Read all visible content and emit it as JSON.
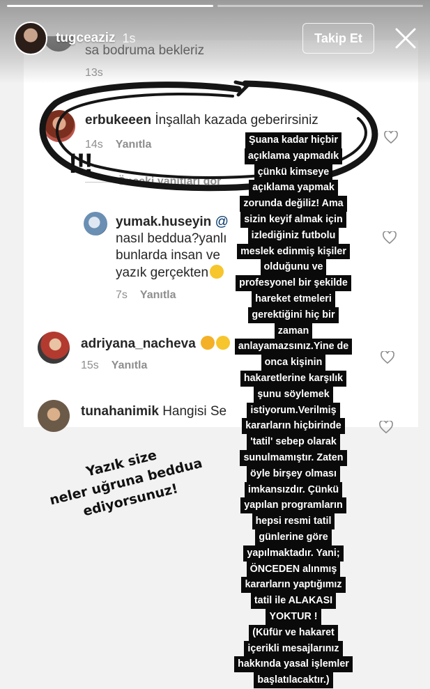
{
  "story": {
    "progress": [
      1.0,
      0.0
    ],
    "username": "tugceaziz",
    "time": "1s",
    "follow_label": "Takip Et",
    "close_icon": "close-icon"
  },
  "screenshot": {
    "prev_comment": {
      "text": "sa bodruma bekleriz",
      "time": "13s",
      "reply": "Yanıtla"
    },
    "comments": [
      {
        "user": "erbukeeen",
        "text": "İnşallah kazada geberirsiniz",
        "time": "14s",
        "reply": "Yanıtla",
        "view_replies": "Önceki yanıtları gör"
      },
      {
        "user": "yumak.huseyin",
        "mention": "@",
        "lines": [
          "nasıl beddua?yanlı",
          "bunlarda insan ve",
          "yazık gerçekten"
        ],
        "time": "7s",
        "reply": "Yanıtla"
      },
      {
        "user": "adriyana_nacheva",
        "time": "15s",
        "reply": "Yanıtla"
      },
      {
        "user": "tunahanimik",
        "text": "Hangisi Se"
      }
    ]
  },
  "overlay": {
    "exclaim": "!!!",
    "caption_lines": [
      "Yazık size",
      "neler uğruna beddua",
      "ediyorsunuz!"
    ],
    "statement_lines": [
      "Şuana kadar  hiçbir",
      "açıklama yapmadık",
      "çünkü kimseye",
      "açıklama yapmak",
      "zorunda değiliz! Ama",
      "sizin keyif almak için",
      "izlediğiniz futbolu",
      "meslek edinmiş kişiler",
      "olduğunu ve",
      "profesyonel bir şekilde",
      "hareket etmeleri",
      "gerektiğini  hiç bir",
      "zaman",
      "anlayamazsınız.Yine de",
      "onca kişinin",
      "hakaretlerine karşılık",
      "şunu söylemek",
      "istiyorum.Verilmiş",
      "kararların hiçbirinde",
      "'tatil' sebep olarak",
      "sunulmamıştır. Zaten",
      "öyle birşey olması",
      "imkansızdır. Çünkü",
      "yapılan programların",
      "hepsi resmi tatil",
      "günlerine göre",
      "yapılmaktadır. Yani;",
      "ÖNCEDEN alınmış",
      "kararların yaptığımız",
      "tatil ile ALAKASI",
      "YOKTUR !",
      "(Küfür ve hakaret",
      "içerikli mesajlarınız",
      "hakkında yasal işlemler",
      "başlatılacaktır.)"
    ]
  }
}
